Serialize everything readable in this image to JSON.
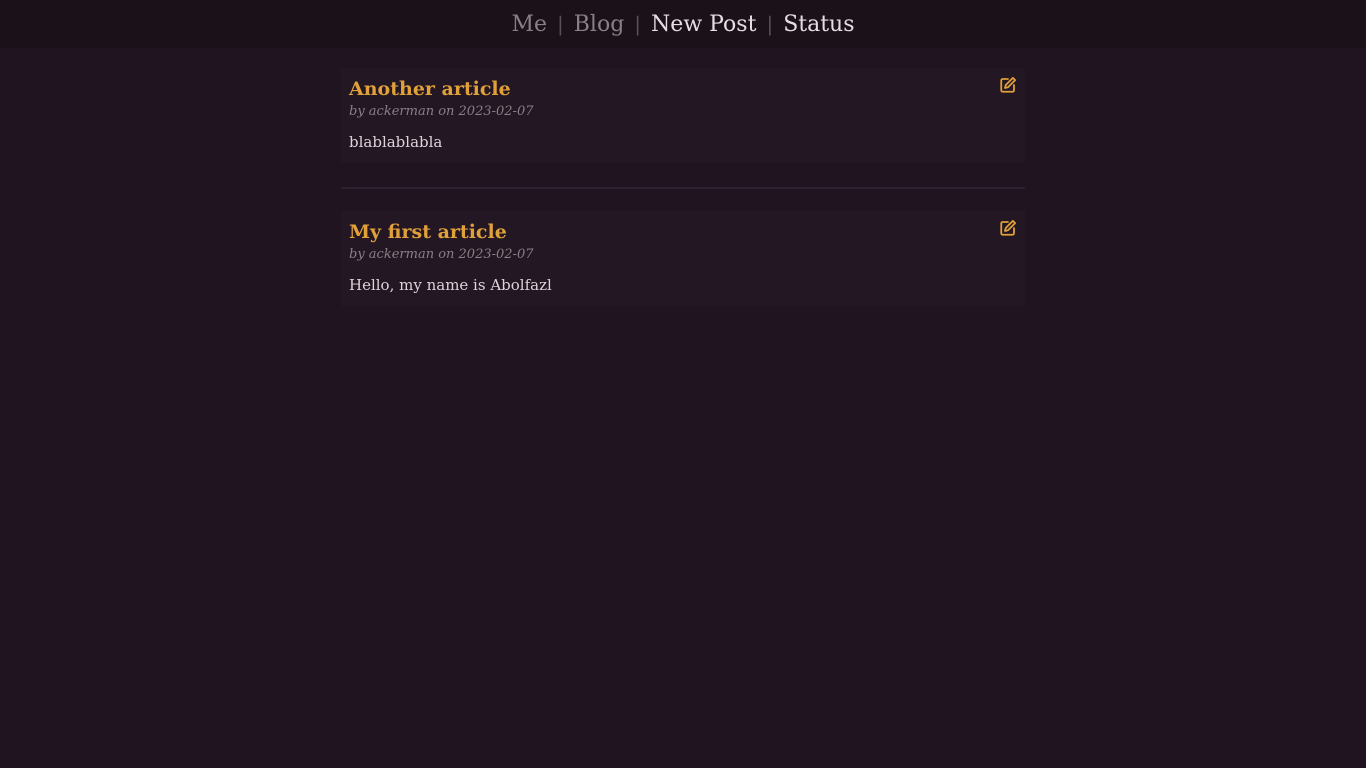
{
  "nav": {
    "items": [
      {
        "label": "Me"
      },
      {
        "label": "Blog"
      },
      {
        "label": "New Post"
      },
      {
        "label": "Status"
      }
    ],
    "separator": "|"
  },
  "posts": [
    {
      "title": "Another article",
      "meta": "by ackerman on 2023-02-07",
      "body": "blablablabla",
      "edit_icon": "edit-icon"
    },
    {
      "title": "My first article",
      "meta": "by ackerman on 2023-02-07",
      "body": "Hello, my name is Abolfazl",
      "edit_icon": "edit-icon"
    }
  ],
  "colors": {
    "background": "#1f1420",
    "accent": "#e0a03a",
    "muted": "#8a7f87",
    "text": "#ddd3da"
  }
}
